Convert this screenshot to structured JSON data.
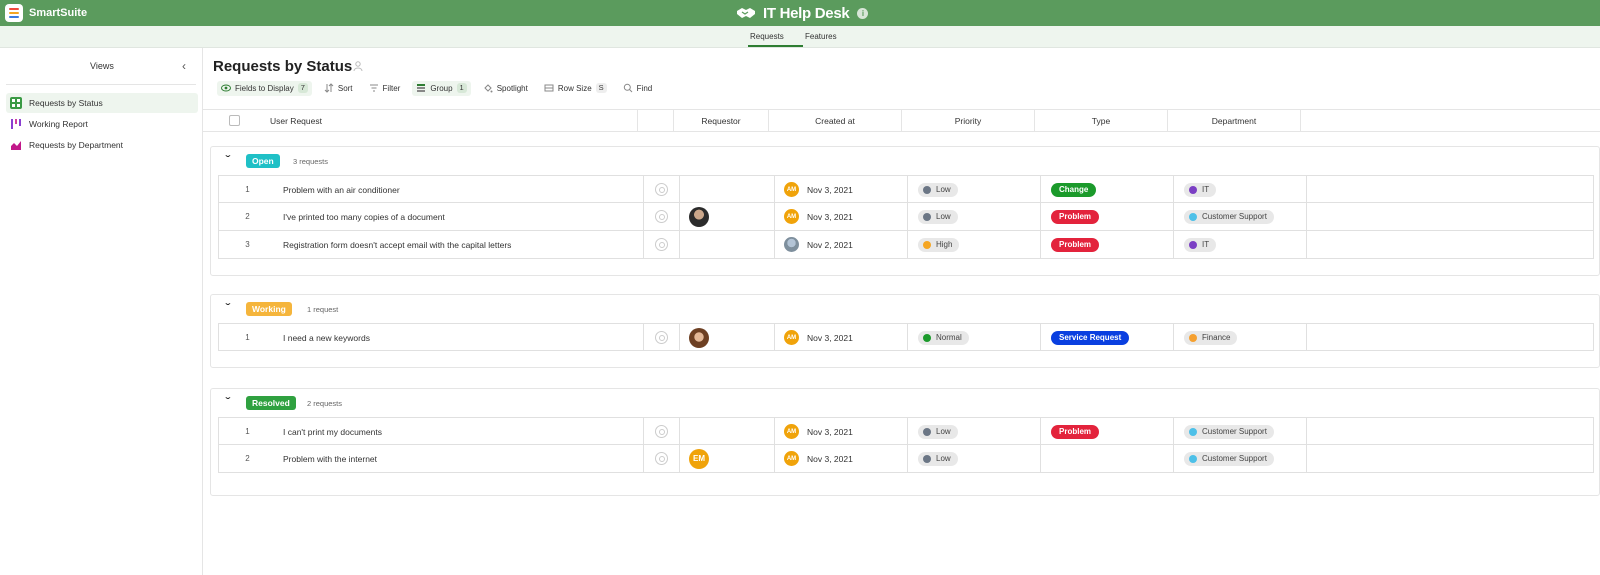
{
  "app": {
    "brand": "SmartSuite",
    "title": "IT Help Desk",
    "tabs": [
      {
        "label": "Requests",
        "active": true
      },
      {
        "label": "Features",
        "active": false
      }
    ]
  },
  "sidebar": {
    "title": "Views",
    "items": [
      {
        "label": "Requests by Status",
        "icon": "grid-view-icon",
        "active": true
      },
      {
        "label": "Working Report",
        "icon": "kanban-icon",
        "active": false
      },
      {
        "label": "Requests by Department",
        "icon": "chart-icon",
        "active": false
      }
    ]
  },
  "view": {
    "title": "Requests by Status",
    "toolbar": {
      "fields": {
        "label": "Fields to Display",
        "count": "7"
      },
      "sort": "Sort",
      "filter": "Filter",
      "group": {
        "label": "Group",
        "count": "1"
      },
      "spotlight": "Spotlight",
      "rowsize": {
        "label": "Row Size",
        "count": "S"
      },
      "find": "Find"
    },
    "columns": {
      "title": "User Request",
      "requestor": "Requestor",
      "created": "Created at",
      "priority": "Priority",
      "type": "Type",
      "department": "Department"
    }
  },
  "colors": {
    "header_green": "#5b9b5d",
    "open": "#1fc0c6",
    "working": "#f5b53c",
    "resolved": "#2fa140",
    "low": "#6b7685",
    "high": "#f5a623",
    "normal": "#1b9a2b",
    "change": "#1b9a2b",
    "problem": "#e3233c",
    "service": "#0a3fe0",
    "it": "#7b3fc4",
    "support": "#4dc0e8",
    "finance": "#f5a030"
  },
  "groups": [
    {
      "status": "Open",
      "count": "3 requests",
      "rows": [
        {
          "num": "1",
          "title": "Problem with an air conditioner",
          "requestor": "",
          "created_by": "AM",
          "date": "Nov 3, 2021",
          "priority": "Low",
          "type": "Change",
          "department": "IT"
        },
        {
          "num": "2",
          "title": "I've printed too many copies of a document",
          "requestor": "photo",
          "created_by": "AM",
          "date": "Nov 3, 2021",
          "priority": "Low",
          "type": "Problem",
          "department": "Customer Support"
        },
        {
          "num": "3",
          "title": "Registration form doesn't accept email with the capital letters",
          "requestor": "",
          "created_by": "photo",
          "date": "Nov 2, 2021",
          "priority": "High",
          "type": "Problem",
          "department": "IT"
        }
      ]
    },
    {
      "status": "Working",
      "count": "1 request",
      "rows": [
        {
          "num": "1",
          "title": "I need a new keywords",
          "requestor": "photo",
          "created_by": "AM",
          "date": "Nov 3, 2021",
          "priority": "Normal",
          "type": "Service Request",
          "department": "Finance"
        }
      ]
    },
    {
      "status": "Resolved",
      "count": "2 requests",
      "rows": [
        {
          "num": "1",
          "title": "I can't print my documents",
          "requestor": "",
          "created_by": "AM",
          "date": "Nov 3, 2021",
          "priority": "Low",
          "type": "Problem",
          "department": "Customer Support"
        },
        {
          "num": "2",
          "title": "Problem with the internet",
          "requestor": "EM",
          "created_by": "AM",
          "date": "Nov 3, 2021",
          "priority": "Low",
          "type": "",
          "department": "Customer Support"
        }
      ]
    }
  ]
}
